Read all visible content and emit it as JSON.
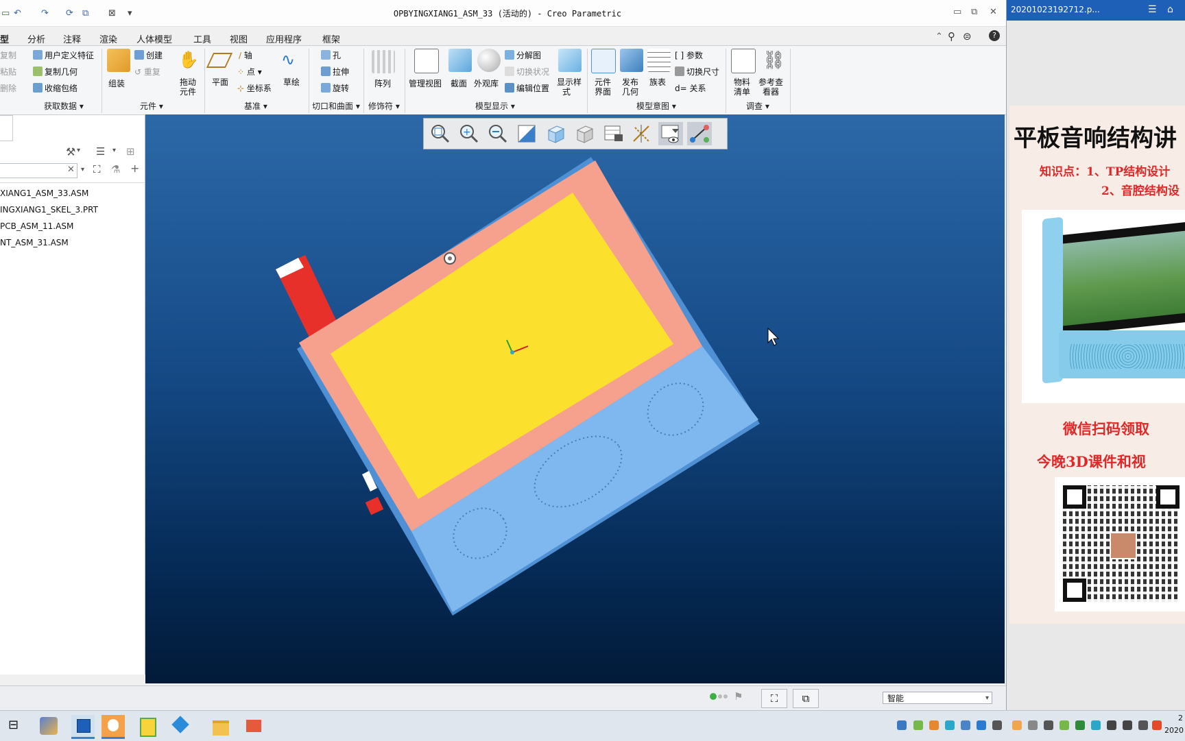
{
  "window": {
    "title": "OPBYINGXIANG1_ASM_33 (活动的) - Creo Parametric",
    "controls": [
      "▭",
      "⧉",
      "✕"
    ]
  },
  "ribbon_tabs": [
    "型",
    "分析",
    "注释",
    "渲染",
    "人体模型",
    "工具",
    "视图",
    "应用程序",
    "框架"
  ],
  "ribbon": {
    "get_data": {
      "copy": "复制",
      "paste": "粘贴",
      "delete": "删除",
      "udf": "用户定义特征",
      "copy_geom": "复制几何",
      "shrinkwrap": "收缩包络",
      "group": "获取数据"
    },
    "component": {
      "assemble": "组装",
      "create": "创建",
      "repeat": "重复",
      "drag_1": "拖动",
      "drag_2": "元件",
      "group": "元件"
    },
    "datum": {
      "plane": "平面",
      "axis": "轴",
      "point": "点",
      "csys": "坐标系",
      "sketch": "草绘",
      "group": "基准"
    },
    "cut_surface": {
      "hole": "孔",
      "extrude": "拉伸",
      "revolve": "旋转",
      "group": "切口和曲面"
    },
    "modifiers": {
      "pattern": "阵列",
      "group": "修饰符"
    },
    "model_display": {
      "manage_views": "管理视图",
      "section": "截面",
      "appearance": "外观库",
      "explode": "分解图",
      "toggle_status": "切换状况",
      "edit_position": "编辑位置",
      "display_style_1": "显示样",
      "display_style_2": "式",
      "group": "模型显示"
    },
    "model_intent": {
      "comp_interface_1": "元件",
      "comp_interface_2": "界面",
      "publish_geom_1": "发布",
      "publish_geom_2": "几何",
      "family_table": "族表",
      "params": "参数",
      "switch_dims": "切换尺寸",
      "relations": "关系",
      "group": "模型意图"
    },
    "investigate": {
      "bom_1": "物料",
      "bom_2": "清单",
      "ref_viewer_1": "参考查",
      "ref_viewer_2": "看器",
      "group": "调查"
    }
  },
  "model_tree": {
    "items": [
      "XIANG1_ASM_33.ASM",
      "INGXIANG1_SKEL_3.PRT",
      "PCB_ASM_11.ASM",
      "NT_ASM_31.ASM"
    ]
  },
  "status_bar": {
    "selection_filter": "智能"
  },
  "right_panel": {
    "file_tab": "20201023192712.p...",
    "ad_title": "平板音响结构讲",
    "ad_point_1": "知识点：1、TP结构设计",
    "ad_point_2": "2、音腔结构设",
    "ad_cta_1": "微信扫码领取",
    "ad_cta_2": "今晚3D课件和视"
  },
  "taskbar": {
    "clock_line_1": "2",
    "clock_line_2": "2020"
  },
  "colors": {
    "device_frame": "#f6a08e",
    "screen": "#fbe02e",
    "speaker_body": "#7eb8ee",
    "component_red": "#e8302a",
    "accent_blue": "#1e5fb8"
  },
  "icons": {
    "view_toolbar": [
      "zoom-fit-icon",
      "zoom-in-icon",
      "zoom-out-icon",
      "repaint-icon",
      "orient-icon",
      "saved-views-icon",
      "display-style-icon",
      "datum-display-icon",
      "spin-center-icon",
      "annotation-display-icon"
    ]
  }
}
